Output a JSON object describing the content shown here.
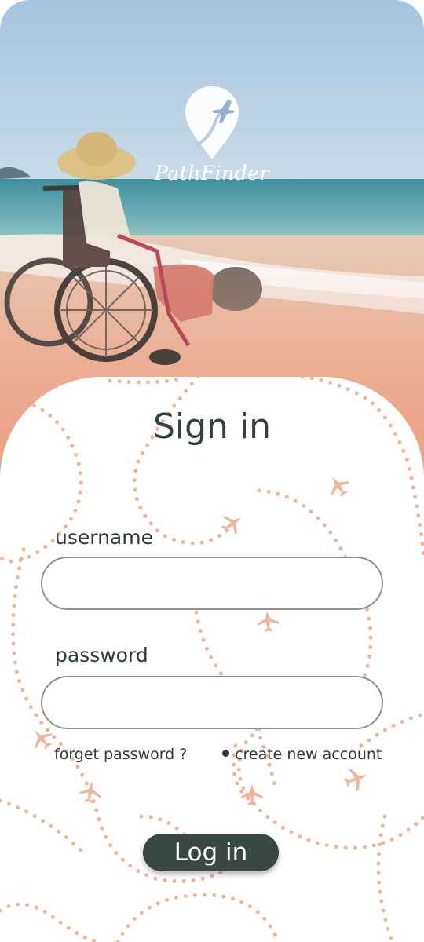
{
  "brand": {
    "name": "PathFinder"
  },
  "signin": {
    "title": "Sign in",
    "username_label": "username",
    "username_value": "",
    "password_label": "password",
    "password_value": "",
    "forget_link": "forget password ?",
    "create_link": "create new account",
    "login_button": "Log in"
  },
  "colors": {
    "accent_dark": "#3a4845",
    "pattern_coral": "#f0b59d",
    "hero_sky": "#a9c6df",
    "hero_sand": "#e9a98d"
  },
  "icons": {
    "logo": "location-pin-airplane-icon",
    "pattern": "airplane-icon"
  }
}
